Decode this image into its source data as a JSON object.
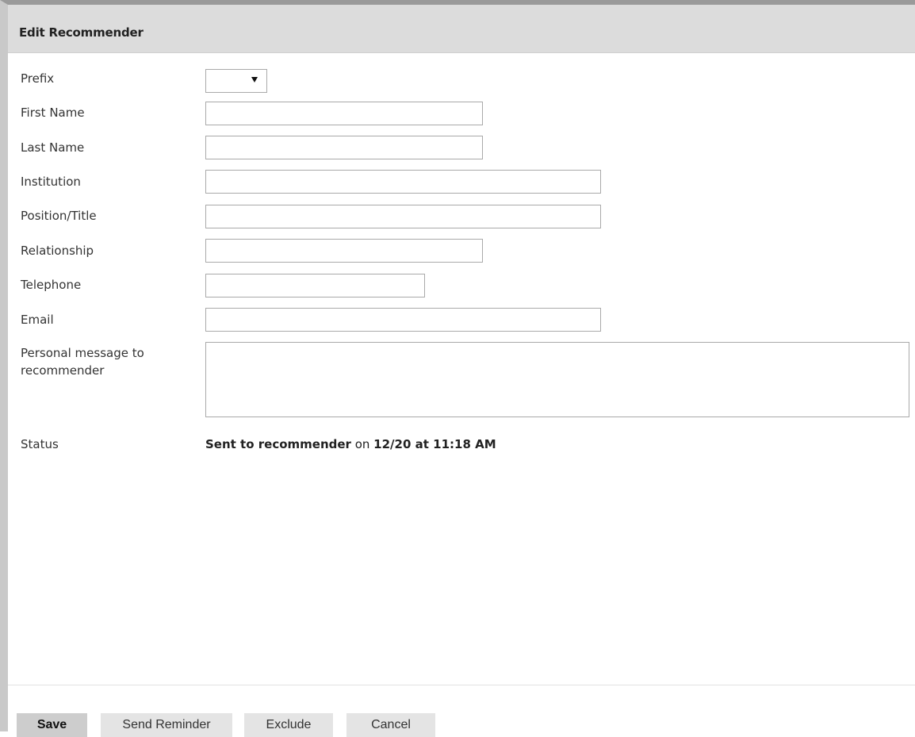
{
  "dialog": {
    "title": "Edit Recommender"
  },
  "form": {
    "prefix": {
      "label": "Prefix",
      "value": ""
    },
    "first_name": {
      "label": "First Name",
      "value": ""
    },
    "last_name": {
      "label": "Last Name",
      "value": ""
    },
    "institution": {
      "label": "Institution",
      "value": ""
    },
    "position_title": {
      "label": "Position/Title",
      "value": ""
    },
    "relationship": {
      "label": "Relationship",
      "value": ""
    },
    "telephone": {
      "label": "Telephone",
      "value": ""
    },
    "email": {
      "label": "Email",
      "value": ""
    },
    "personal_message": {
      "label_line1": "Personal message to",
      "label_line2": "recommender",
      "value": ""
    },
    "status": {
      "label": "Status",
      "state": "Sent to recommender",
      "on_text": " on ",
      "datetime": "12/20 at 11:18 AM"
    }
  },
  "buttons": {
    "save": "Save",
    "send_reminder": "Send Reminder",
    "exclude": "Exclude",
    "cancel": "Cancel"
  },
  "colors": {
    "title_bar": "#dcdcdc",
    "primary_button": "#cdcdcd",
    "secondary_button": "#e4e4e4"
  }
}
